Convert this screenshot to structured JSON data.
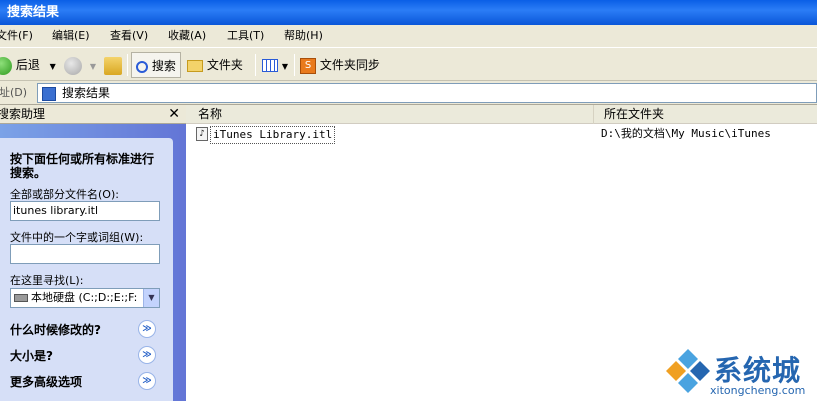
{
  "window": {
    "title": "搜索结果"
  },
  "menu": [
    "文件(F)",
    "编辑(E)",
    "查看(V)",
    "收藏(A)",
    "工具(T)",
    "帮助(H)"
  ],
  "toolbar": {
    "back": "后退",
    "search": "搜索",
    "folders": "文件夹",
    "sync": "文件夹同步"
  },
  "address": {
    "label": "地址(D)",
    "value": "搜索结果"
  },
  "assistant": {
    "title": "搜索助理",
    "close": "✕",
    "instruction": "按下面任何或所有标准进行搜索。",
    "filename_label": "全部或部分文件名(O):",
    "filename_value": "itunes library.itl",
    "phrase_label": "文件中的一个字或词组(W):",
    "phrase_value": "",
    "lookin_label": "在这里寻找(L):",
    "lookin_value": "本地硬盘 (C:;D:;E:;F:",
    "sections": [
      "什么时候修改的?",
      "大小是?",
      "更多高级选项"
    ]
  },
  "columns": {
    "name": "名称",
    "folder": "所在文件夹"
  },
  "files": [
    {
      "name": "iTunes Library.itl",
      "folder": "D:\\我的文档\\My Music\\iTunes"
    }
  ],
  "watermark": {
    "brand": "系统城",
    "url": "xitongcheng.com"
  },
  "colors": {
    "title": "#0a5fe6",
    "chrome": "#ece9d8",
    "pane": "#6f8fde",
    "card": "#d6dff7",
    "accent": "#215dc6"
  }
}
